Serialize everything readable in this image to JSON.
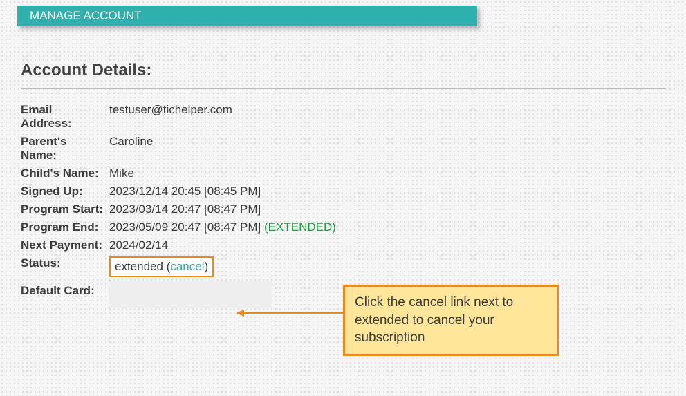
{
  "header": {
    "title": "MANAGE ACCOUNT"
  },
  "section_title": "Account Details:",
  "rows": {
    "email": {
      "label": "Email Address:",
      "value": "testuser@tichelper.com"
    },
    "parent": {
      "label": "Parent's Name:",
      "value": "Caroline"
    },
    "child": {
      "label": "Child's Name:",
      "value": "Mike"
    },
    "signed_up": {
      "label": "Signed Up:",
      "value": "2023/12/14 20:45 [08:45 PM]"
    },
    "program_start": {
      "label": "Program Start:",
      "value": "2023/03/14 20:47 [08:47 PM]"
    },
    "program_end": {
      "label": "Program End:",
      "value": "2023/05/09 20:47 [08:47 PM] ",
      "extended": "(EXTENDED)"
    },
    "next_payment": {
      "label": "Next Payment:",
      "value": "2024/02/14"
    },
    "status": {
      "label": "Status:",
      "prefix": "extended (",
      "link": "cancel",
      "suffix": ")"
    },
    "default_card": {
      "label": "Default Card:"
    }
  },
  "callout": {
    "text": "Click the cancel link next to extended to cancel your subscription"
  },
  "colors": {
    "accent": "#30b0ac",
    "highlight_border": "#e78a1f",
    "callout_bg": "#ffe69a",
    "extended_text": "#1c9b3f"
  }
}
